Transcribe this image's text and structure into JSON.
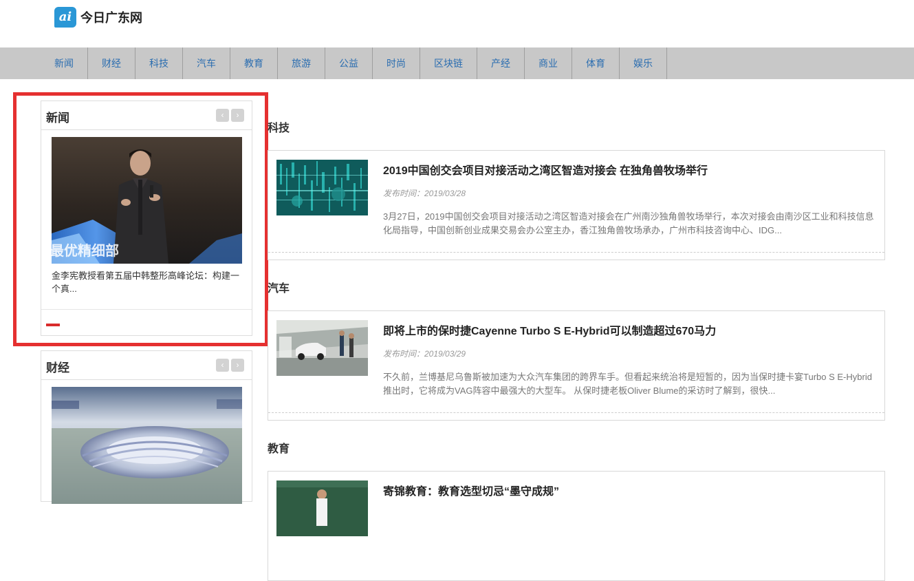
{
  "site": {
    "logo_badge": "ai",
    "name": "今日广东网"
  },
  "nav": [
    "新闻",
    "财经",
    "科技",
    "汽车",
    "教育",
    "旅游",
    "公益",
    "时尚",
    "区块链",
    "产经",
    "商业",
    "体育",
    "娱乐"
  ],
  "sidebar": {
    "news": {
      "title": "新闻",
      "prev": "‹",
      "next": "›",
      "caption": "金李宪教授看第五届中韩整形高峰论坛：构建一个真...",
      "image_text": "最优精细部"
    },
    "finance": {
      "title": "财经",
      "prev": "‹",
      "next": "›"
    }
  },
  "sections": [
    {
      "heading": "科技",
      "title": "2019中国创交会项目对接活动之湾区智造对接会 在独角兽牧场举行",
      "date": "发布时间：2019/03/28",
      "desc": "3月27日，2019中国创交会项目对接活动之湾区智造对接会在广州南沙独角兽牧场举行，本次对接会由南沙区工业和科技信息化局指导，中国创新创业成果交易会办公室主办，香江独角兽牧场承办，广州市科技咨询中心、IDG..."
    },
    {
      "heading": "汽车",
      "title": "即将上市的保时捷Cayenne Turbo S E-Hybrid可以制造超过670马力",
      "date": "发布时间：2019/03/29",
      "desc": "不久前，兰博基尼乌鲁斯被加速为大众汽车集团的跨界车手。但看起来统治将是短暂的，因为当保时捷卡宴Turbo S E-Hybrid推出时，它将成为VAG阵容中最强大的大型车。 从保时捷老板Oliver Blume的采访时了解到，很快..."
    },
    {
      "heading": "教育",
      "title": "寄锦教育：教育选型切忌“墨守成规”"
    }
  ],
  "colors": {
    "nav_bg": "#c8c8c8",
    "nav_text": "#2a6db0",
    "highlight": "#e53030",
    "logo": "#2a97d6"
  }
}
